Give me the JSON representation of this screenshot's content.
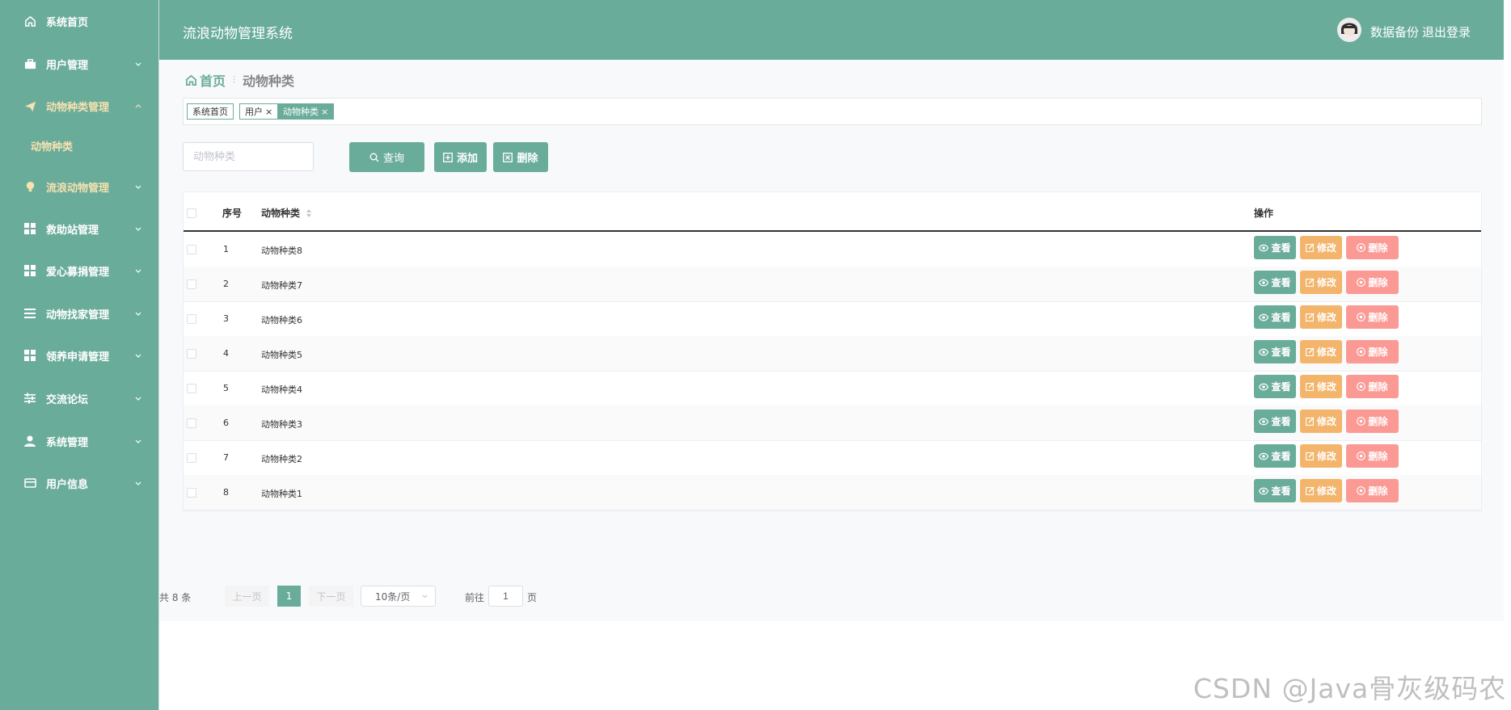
{
  "sidebar": {
    "items": [
      {
        "label": "系统首页",
        "icon": "home-icon"
      },
      {
        "label": "用户管理",
        "icon": "briefcase-icon"
      },
      {
        "label": "动物种类管理",
        "icon": "paper-plane-icon"
      },
      {
        "label": "流浪动物管理",
        "icon": "lightbulb-icon"
      },
      {
        "label": "救助站管理",
        "icon": "grid-icon"
      },
      {
        "label": "爱心募捐管理",
        "icon": "grid-icon"
      },
      {
        "label": "动物找家管理",
        "icon": "list-icon"
      },
      {
        "label": "领养申请管理",
        "icon": "grid-icon"
      },
      {
        "label": "交流论坛",
        "icon": "sliders-icon"
      },
      {
        "label": "系统管理",
        "icon": "user-icon"
      },
      {
        "label": "用户信息",
        "icon": "card-icon"
      }
    ],
    "sub_item": "动物种类",
    "open_color": "#f7e2b0"
  },
  "header": {
    "title": "流浪动物管理系统",
    "backup_link": "数据备份",
    "logout_link": "退出登录"
  },
  "breadcrumb": {
    "home": "首页",
    "current": "动物种类"
  },
  "tags": [
    {
      "label": "系统首页",
      "closable": false
    },
    {
      "label": "用户",
      "closable": true
    },
    {
      "label": "动物种类",
      "closable": true
    }
  ],
  "tag_close": "×",
  "search": {
    "placeholder": "动物种类",
    "query_label": "查询",
    "add_label": "添加",
    "delete_label": "删除"
  },
  "table": {
    "columns": [
      "序号",
      "动物种类",
      "操作"
    ],
    "rows": [
      {
        "index": "1",
        "name": "动物种类8"
      },
      {
        "index": "2",
        "name": "动物种类7"
      },
      {
        "index": "3",
        "name": "动物种类6"
      },
      {
        "index": "4",
        "name": "动物种类5"
      },
      {
        "index": "5",
        "name": "动物种类4"
      },
      {
        "index": "6",
        "name": "动物种类3"
      },
      {
        "index": "7",
        "name": "动物种类2"
      },
      {
        "index": "8",
        "name": "动物种类1"
      }
    ],
    "actions": {
      "view": "查看",
      "edit": "修改",
      "delete": "删除"
    }
  },
  "pagination": {
    "total": "共 8 条",
    "prev": "上一页",
    "current_page": "1",
    "next": "下一页",
    "page_size": "10条/页",
    "goto_prefix": "前往",
    "goto_value": "1",
    "goto_suffix": "页"
  },
  "colors": {
    "primary": "#6aac9a",
    "warning": "#f3b56b",
    "danger": "#fb9a95"
  },
  "watermark": "CSDN @Java骨灰级码农"
}
